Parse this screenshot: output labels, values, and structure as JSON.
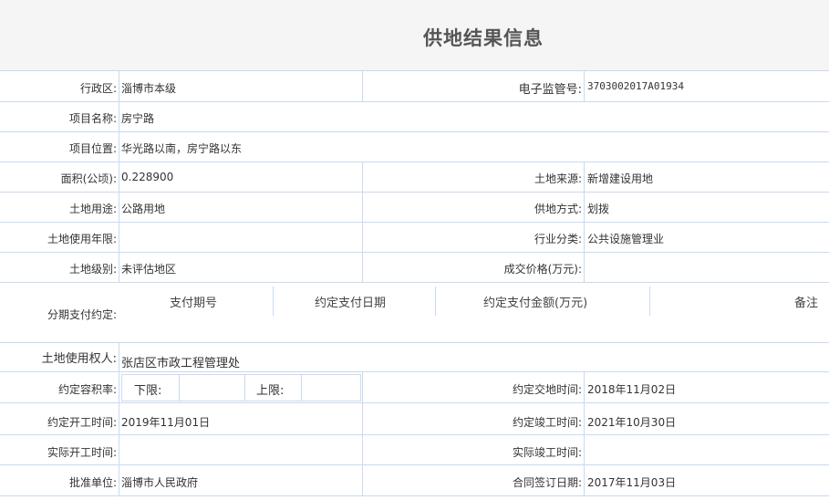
{
  "title": "供地结果信息",
  "fields": {
    "district": {
      "label": "行政区:",
      "value": "淄博市本级"
    },
    "supervision_no": {
      "label": "电子监管号:",
      "value": "3703002017A01934"
    },
    "project_name": {
      "label": "项目名称:",
      "value": "房宁路"
    },
    "project_location": {
      "label": "项目位置:",
      "value": "华光路以南，房宁路以东"
    },
    "area": {
      "label": "面积(公顷):",
      "value": "0.228900"
    },
    "land_source": {
      "label": "土地来源:",
      "value": "新增建设用地"
    },
    "land_use": {
      "label": "土地用途:",
      "value": "公路用地"
    },
    "supply_method": {
      "label": "供地方式:",
      "value": "划拨"
    },
    "use_term": {
      "label": "土地使用年限:",
      "value": ""
    },
    "industry": {
      "label": "行业分类:",
      "value": "公共设施管理业"
    },
    "land_grade": {
      "label": "土地级别:",
      "value": "未评估地区"
    },
    "deal_price": {
      "label": "成交价格(万元):",
      "value": ""
    },
    "installment": {
      "label": "分期支付约定:",
      "headers": [
        "支付期号",
        "约定支付日期",
        "约定支付金额(万元)",
        "备注"
      ]
    },
    "land_user": {
      "label": "土地使用权人:",
      "value": "张店区市政工程管理处"
    },
    "plot_ratio": {
      "label": "约定容积率:",
      "lower_label": "下限:",
      "lower_value": "",
      "upper_label": "上限:",
      "upper_value": ""
    },
    "delivery_time": {
      "label": "约定交地时间:",
      "value": "2018年11月02日"
    },
    "start_time": {
      "label": "约定开工时间:",
      "value": "2019年11月01日"
    },
    "finish_time": {
      "label": "约定竣工时间:",
      "value": "2021年10月30日"
    },
    "actual_start": {
      "label": "实际开工时间:",
      "value": ""
    },
    "actual_finish": {
      "label": "实际竣工时间:",
      "value": ""
    },
    "approver": {
      "label": "批准单位:",
      "value": "淄博市人民政府"
    },
    "contract_date": {
      "label": "合同签订日期:",
      "value": "2017年11月03日"
    }
  }
}
